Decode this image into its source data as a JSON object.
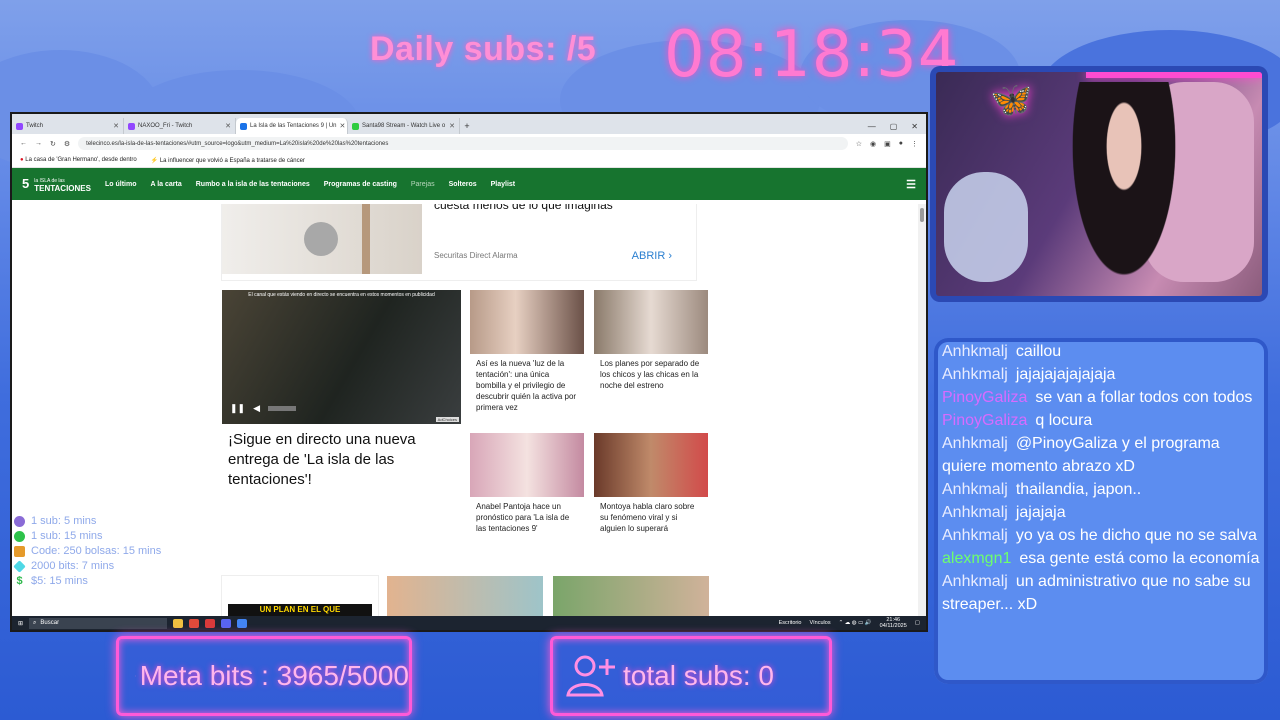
{
  "overlay": {
    "daily_subs": "Daily subs: /5",
    "clock": "08:18:34",
    "meta_bits": "Meta bits : 3965/5000",
    "total_subs": "total subs: 0"
  },
  "goals": [
    {
      "color": "#8a6bd6",
      "text": "1 sub: 5 mins"
    },
    {
      "color": "#2ec24a",
      "text": "1 sub: 15 mins"
    },
    {
      "color": "#e59a2a",
      "text": "Code: 250 bolsas: 15 mins"
    },
    {
      "color": "#4fd8e6",
      "text": "2000 bits: 7 mins"
    },
    {
      "color": "#2eb84a",
      "text": "$5: 15 mins"
    }
  ],
  "browser": {
    "tabs": [
      {
        "label": "Twitch",
        "favicon": "#9146ff",
        "active": false
      },
      {
        "label": "NAXOO_Fri - Twitch",
        "favicon": "#9146ff",
        "active": false
      },
      {
        "label": "La Isla de las Tentaciones 9 | Un",
        "favicon": "#1a73e8",
        "active": true
      },
      {
        "label": "Santa98 Stream - Watch Live o",
        "favicon": "#2ecc40",
        "active": false
      }
    ],
    "url": "telecinco.es/la-isla-de-las-tentaciones/#utm_source=logo&utm_medium=La%20isla%20de%20las%20tentaciones",
    "bookmarks": [
      "La casa de 'Gran Hermano', desde dentro",
      "La influencer que volvió a España a tratarse de cáncer"
    ],
    "site": {
      "logo_top": "la ISLA de las",
      "logo_main": "TENTACIONES",
      "logo_num": "5",
      "nav": [
        "Lo último",
        "A la carta",
        "Rumbo a la isla de las tentaciones",
        "Programas de casting",
        "Parejas",
        "Solteros",
        "Playlist"
      ]
    },
    "ad": {
      "title": "cuesta menos de lo que imaginas",
      "sponsor": "Securitas Direct Alarma",
      "cta": "ABRIR"
    },
    "video": {
      "notice": "El canal que estás viendo en directo se encuentra en estos momentos en publicidad",
      "badge": "AdChoices"
    },
    "headline": "¡Sigue en directo una nueva entrega de 'La isla de las tentaciones'!",
    "cards": [
      "Así es la nueva 'luz de la tentación': una única bombilla y el privilegio de descubrir quién la activa por primera vez",
      "Los planes por separado de los chicos y las chicas en la noche del estreno",
      "Anabel Pantoja hace un pronóstico para 'La isla de las tentaciones 9'",
      "Montoya habla claro sobre su fenómeno viral y si alguien lo superará"
    ],
    "promo": "UN PLAN EN EL QUE",
    "taskbar": {
      "search": "Buscar",
      "desktop": "Escritorio",
      "links": "Vínculos",
      "time": "21:46",
      "date": "04/11/2025"
    }
  },
  "chat": [
    {
      "user": "Anhkmalj",
      "color": "#e8ecff",
      "text": "caillou"
    },
    {
      "user": "Anhkmalj",
      "color": "#e8ecff",
      "text": "jajajajajajajaja"
    },
    {
      "user": "PinoyGaliza",
      "color": "#d86bff",
      "text": "se van a follar todos con todos"
    },
    {
      "user": "PinoyGaliza",
      "color": "#d86bff",
      "text": "q locura"
    },
    {
      "user": "Anhkmalj",
      "color": "#e8ecff",
      "text": "@PinoyGaliza y el programa quiere momento abrazo xD"
    },
    {
      "user": "Anhkmalj",
      "color": "#e8ecff",
      "text": "thailandia, japon.."
    },
    {
      "user": "Anhkmalj",
      "color": "#e8ecff",
      "text": "jajajaja"
    },
    {
      "user": "Anhkmalj",
      "color": "#e8ecff",
      "text": "yo ya os he dicho que no se salva"
    },
    {
      "user": "alexmgn1",
      "color": "#6dff6d",
      "text": "esa gente está como la economía"
    },
    {
      "user": "Anhkmalj",
      "color": "#e8ecff",
      "text": "un administrativo que no sabe su streaper... xD"
    }
  ]
}
